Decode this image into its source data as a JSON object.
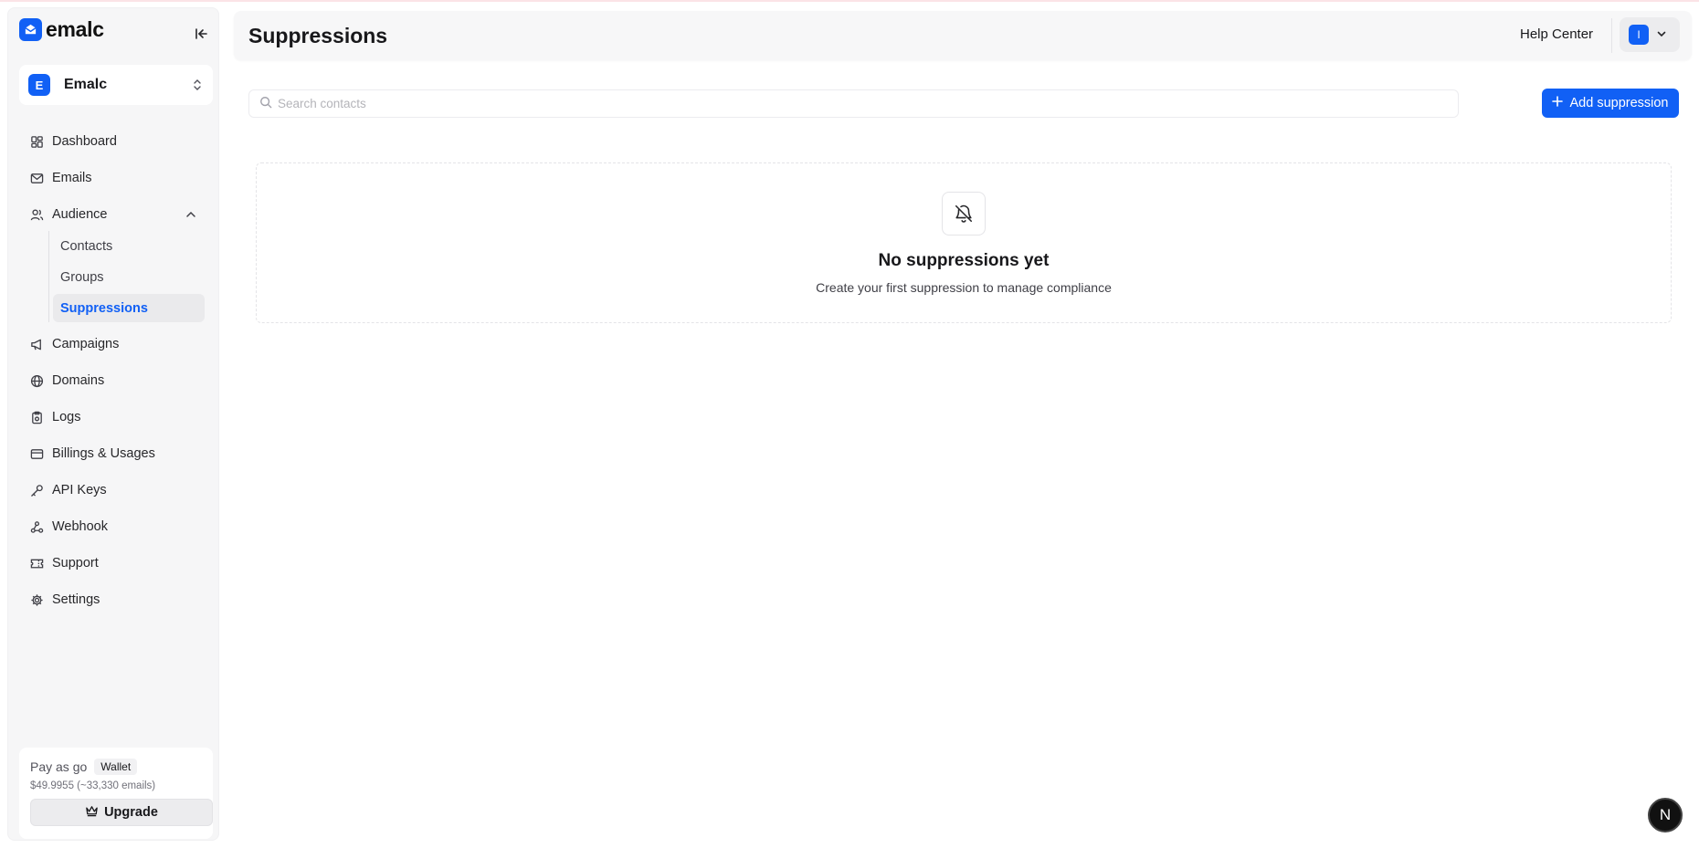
{
  "brand": {
    "name": "emalc"
  },
  "workspace": {
    "avatar": "E",
    "name": "Emalc"
  },
  "sidebar": {
    "items": [
      {
        "label": "Dashboard",
        "icon": "grid-icon"
      },
      {
        "label": "Emails",
        "icon": "mail-icon"
      },
      {
        "label": "Audience",
        "icon": "users-icon"
      },
      {
        "label": "Campaigns",
        "icon": "megaphone-icon"
      },
      {
        "label": "Domains",
        "icon": "globe-icon"
      },
      {
        "label": "Logs",
        "icon": "clipboard-icon"
      },
      {
        "label": "Billings & Usages",
        "icon": "credit-card-icon"
      },
      {
        "label": "API Keys",
        "icon": "key-icon"
      },
      {
        "label": "Webhook",
        "icon": "webhook-icon"
      },
      {
        "label": "Support",
        "icon": "ticket-icon"
      },
      {
        "label": "Settings",
        "icon": "gear-icon"
      }
    ],
    "audience_sub": [
      {
        "label": "Contacts"
      },
      {
        "label": "Groups"
      },
      {
        "label": "Suppressions",
        "active": true
      }
    ]
  },
  "plan": {
    "name": "Pay as go",
    "badge": "Wallet",
    "balance": "$49.9955 (~33,330 emails)",
    "upgrade_label": "Upgrade"
  },
  "header": {
    "title": "Suppressions",
    "help_label": "Help Center",
    "user_avatar": "I"
  },
  "toolbar": {
    "search_placeholder": "Search contacts",
    "add_label": "Add suppression"
  },
  "empty_state": {
    "title": "No suppressions yet",
    "subtitle": "Create your first suppression to manage compliance"
  },
  "dev_badge": "N",
  "colors": {
    "accent": "#1160f5",
    "sidebar_bg": "#f6f6f7"
  }
}
